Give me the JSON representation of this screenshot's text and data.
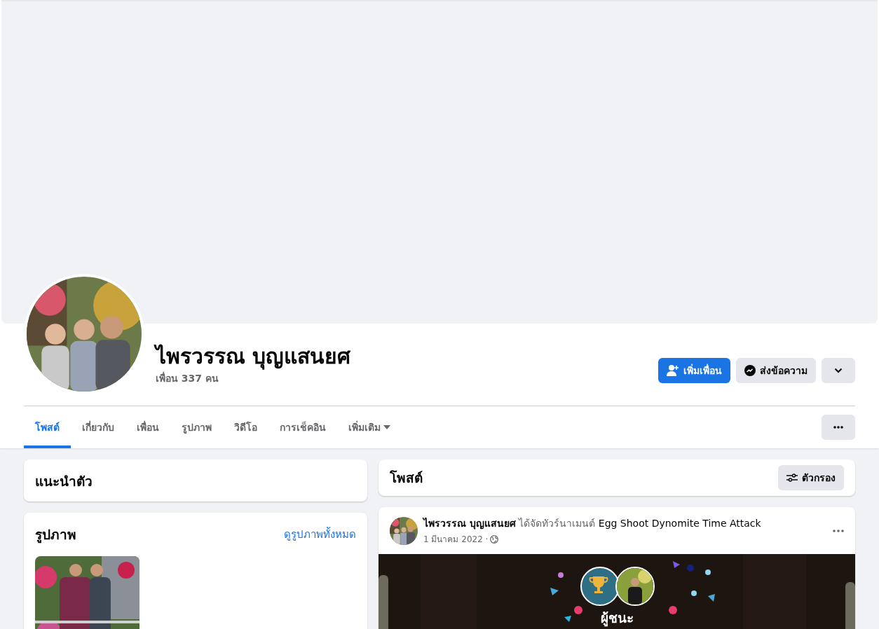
{
  "profile": {
    "name": "ไพรวรรณ บุญแสนยศ",
    "friends": "เพื่อน 337 คน"
  },
  "actions": [
    {
      "kind": "primary",
      "label": "เพิ่มเพื่อน"
    },
    {
      "kind": "message",
      "label": "ส่งข้อความ"
    },
    {
      "kind": "menu"
    }
  ],
  "tabs": [
    {
      "label": "โพสต์",
      "selected": true
    },
    {
      "label": "เกี่ยวกับ",
      "selected": false
    },
    {
      "label": "เพื่อน",
      "selected": false
    },
    {
      "label": "รูปภาพ",
      "selected": false
    },
    {
      "label": "วิดีโอ",
      "selected": false
    },
    {
      "label": "การเช็คอิน",
      "selected": false
    },
    {
      "label": "เพิ่มเติม",
      "selected": false,
      "dropdown": true
    }
  ],
  "intro": {
    "title": "แนะนำตัว"
  },
  "photos": {
    "title": "รูปภาพ",
    "link": "ดูรูปภาพทั้งหมด"
  },
  "posts": {
    "title": "โพสต์",
    "filter": "ตัวกรอง"
  },
  "post": {
    "author": "ไพรวรรณ บุญแสนยศ",
    "action": "ได้จัดทัวร์นาเมนต์",
    "game": "Egg Shoot Dynomite Time Attack",
    "date": "1 มีนาคม 2022 ·",
    "card": {
      "heading": "ผู้ชนะ"
    }
  }
}
